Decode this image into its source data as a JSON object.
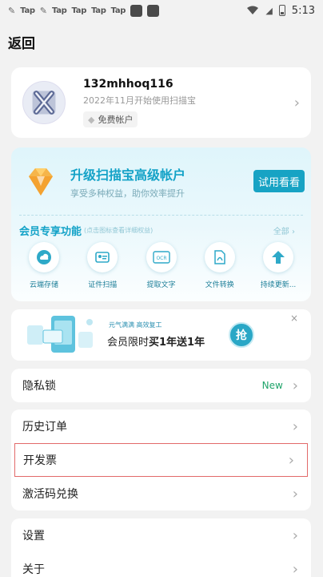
{
  "status_bar": {
    "apps": [
      "Tap",
      "Tap",
      "Tap",
      "Tap",
      "Tap"
    ],
    "time": "5:13"
  },
  "header": {
    "title": "返回"
  },
  "user": {
    "name": "132mhhoq116",
    "since": "2022年11月开始使用扫描宝",
    "badge": "免费帐户"
  },
  "vip": {
    "title": "升级扫描宝高级帐户",
    "subtitle": "享受多种权益，助你效率提升",
    "try_button": "试用看看",
    "features_title": "会员专享功能",
    "features_hint": "(点击图标查看详细权益)",
    "all_label": "全部 ›",
    "features": [
      {
        "label": "云端存储",
        "icon": "cloud-storage-icon"
      },
      {
        "label": "证件扫描",
        "icon": "id-card-icon"
      },
      {
        "label": "提取文字",
        "icon": "ocr-icon"
      },
      {
        "label": "文件转换",
        "icon": "pdf-convert-icon"
      },
      {
        "label": "持续更新...",
        "icon": "update-arrow-icon"
      }
    ],
    "accent": "#17a3c4"
  },
  "promo": {
    "small_text": "元气满满  高效复工",
    "main_prefix": "会员限时",
    "main_bold": "买1年送1年",
    "button": "抢",
    "close": "×"
  },
  "menu": {
    "group1": [
      {
        "label": "隐私锁",
        "tag": "New"
      }
    ],
    "group2": [
      {
        "label": "历史订单"
      },
      {
        "label": "开发票"
      },
      {
        "label": "激活码兑换"
      }
    ],
    "group3": [
      {
        "label": "设置"
      },
      {
        "label": "关于"
      }
    ]
  }
}
